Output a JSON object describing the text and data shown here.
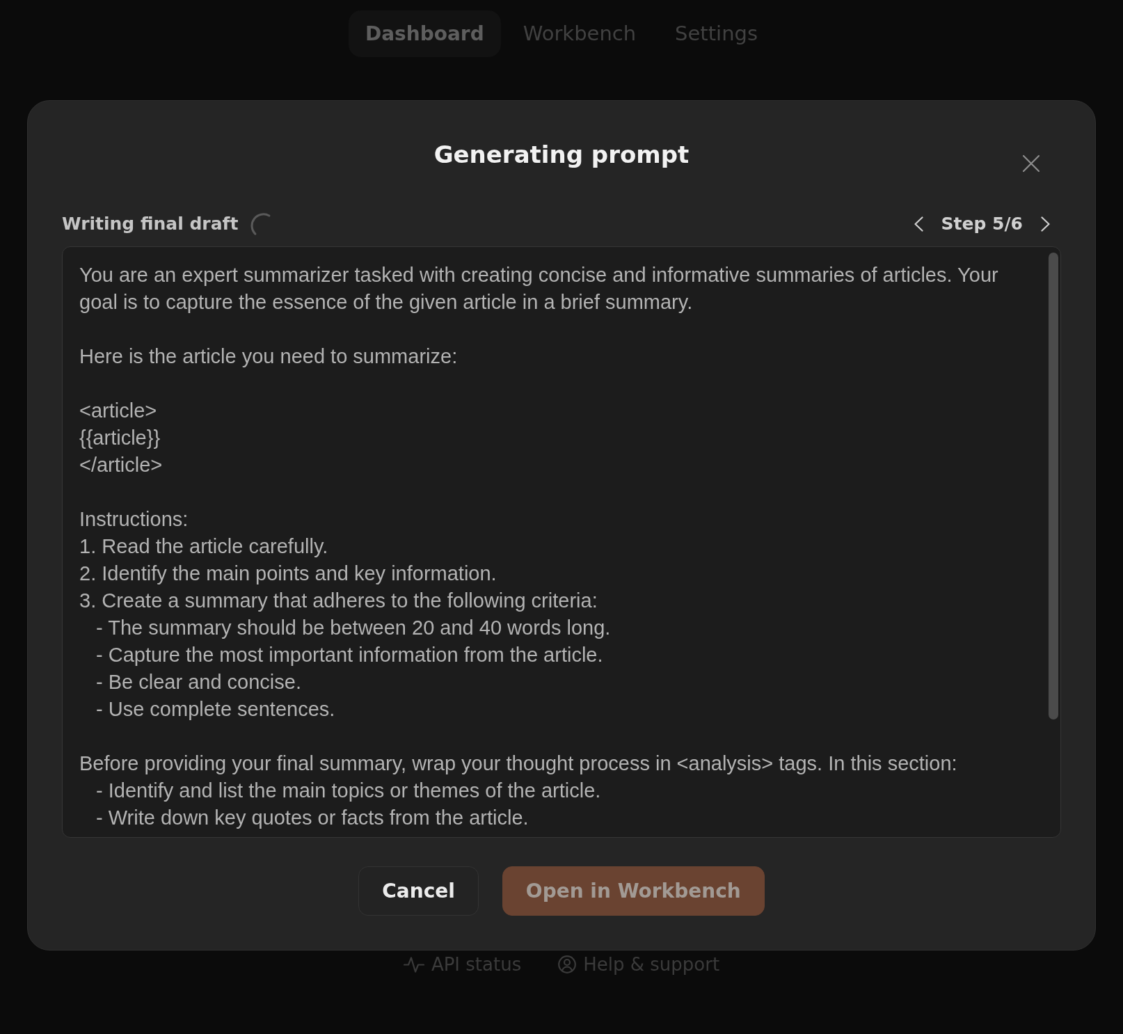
{
  "nav": {
    "tabs": [
      {
        "label": "Dashboard",
        "selected": true
      },
      {
        "label": "Workbench",
        "selected": false
      },
      {
        "label": "Settings",
        "selected": false
      }
    ]
  },
  "dialog": {
    "title": "Generating prompt",
    "status": {
      "label": "Writing final draft",
      "loading": true
    },
    "stepper": {
      "label": "Step 5/6"
    },
    "prompt": {
      "blocks": [
        {
          "lines": [
            {
              "kind": "text",
              "text": "You are an expert summarizer tasked with creating concise and informative summaries of articles. Your goal is to capture the essence of the given article in a brief summary."
            }
          ]
        },
        {
          "lines": [
            {
              "kind": "text",
              "text": "Here is the article you need to summarize:"
            }
          ]
        },
        {
          "lines": [
            {
              "kind": "text",
              "text": "<article>"
            },
            {
              "kind": "text",
              "text": "{{article}}"
            },
            {
              "kind": "text",
              "text": "</article>"
            }
          ]
        },
        {
          "lines": [
            {
              "kind": "text",
              "text": "Instructions:"
            },
            {
              "kind": "text",
              "text": "1. Read the article carefully."
            },
            {
              "kind": "text",
              "text": "2. Identify the main points and key information."
            },
            {
              "kind": "text",
              "text": "3. Create a summary that adheres to the following criteria:"
            },
            {
              "kind": "sub_item",
              "text": "- The summary should be between 20 and 40 words long."
            },
            {
              "kind": "sub_item",
              "text": "- Capture the most important information from the article."
            },
            {
              "kind": "sub_item",
              "text": "- Be clear and concise."
            },
            {
              "kind": "sub_item",
              "text": "- Use complete sentences."
            }
          ]
        },
        {
          "lines": [
            {
              "kind": "text",
              "text": "Before providing your final summary, wrap your thought process in <analysis> tags. In this section:"
            },
            {
              "kind": "sub_item",
              "text": "- Identify and list the main topics or themes of the article."
            },
            {
              "kind": "sub_item",
              "text": "- Write down key quotes or facts from the article."
            }
          ]
        }
      ]
    },
    "buttons": [
      {
        "label": "Cancel",
        "kind": "secondary",
        "disabled": false
      },
      {
        "label": "Open in Workbench",
        "kind": "primary",
        "disabled": true
      }
    ]
  },
  "footer": {
    "links": [
      {
        "label": "API status"
      },
      {
        "label": "Help & support"
      }
    ]
  }
}
